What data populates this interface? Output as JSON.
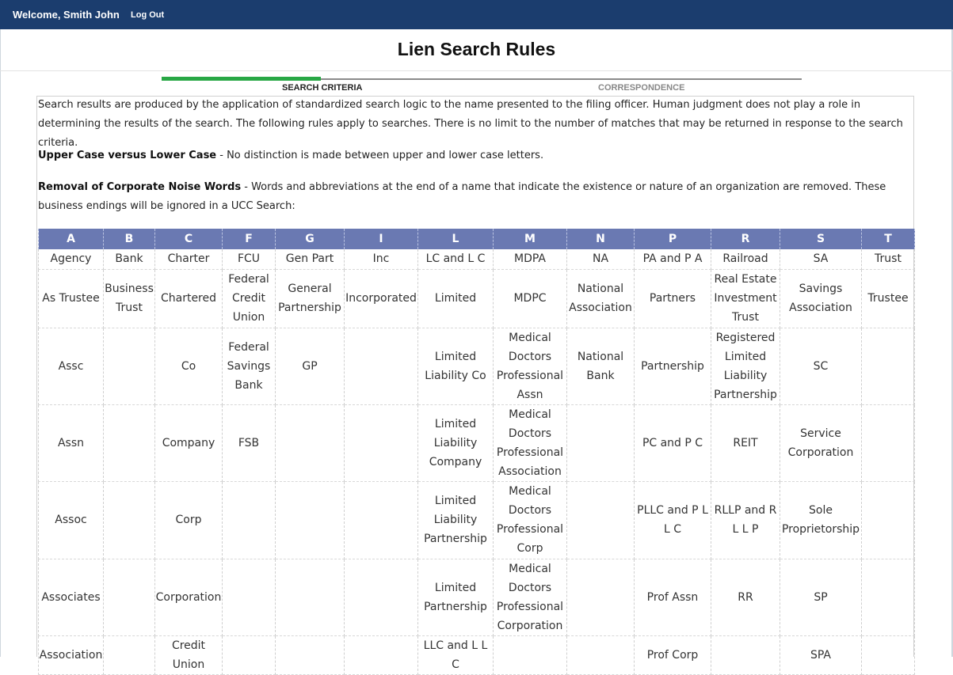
{
  "header": {
    "welcome": "Welcome, Smith John",
    "logout": "Log Out"
  },
  "page": {
    "title": "Lien Search Rules"
  },
  "steps": {
    "step1": "SEARCH CRITERIA",
    "step2": "CORRESPONDENCE",
    "active_color": "#28a745"
  },
  "content": {
    "intro": "Search results are produced by the application of standardized search logic to the name presented to the filing officer. Human judgment does not play a role in determining the results of the search. The following rules apply to searches. There is no limit to the number of matches that may be returned in response to the search criteria.",
    "rule1_title": "Upper Case versus Lower Case",
    "rule1_text": " - No distinction is made between upper and lower case letters.",
    "rule2_title": "Removal of Corporate Noise Words",
    "rule2_text": " - Words and abbreviations at the end of a name that indicate the existence or nature of an organization are removed. These business endings will be ignored in a UCC Search:"
  },
  "table": {
    "header_color": "#6a79b2",
    "headers": [
      "A",
      "B",
      "C",
      "F",
      "G",
      "I",
      "L",
      "M",
      "N",
      "P",
      "R",
      "S",
      "T"
    ],
    "rows": [
      [
        "Agency",
        "Bank",
        "Charter",
        "FCU",
        "Gen Part",
        "Inc",
        "LC and L C",
        "MDPA",
        "NA",
        "PA and P A",
        "Railroad",
        "SA",
        "Trust"
      ],
      [
        "As Trustee",
        "Business Trust",
        "Chartered",
        "Federal Credit Union",
        "General Partnership",
        "Incorporated",
        "Limited",
        "MDPC",
        "National Association",
        "Partners",
        "Real Estate Investment Trust",
        "Savings Association",
        "Trustee"
      ],
      [
        "Assc",
        "",
        "Co",
        "Federal Savings Bank",
        "GP",
        "",
        "Limited Liability Co",
        "Medical Doctors Professional Assn",
        "National Bank",
        "Partnership",
        "Registered Limited Liability Partnership",
        "SC",
        ""
      ],
      [
        "Assn",
        "",
        "Company",
        "FSB",
        "",
        "",
        "Limited Liability Company",
        "Medical Doctors Professional Association",
        "",
        "PC and P C",
        "REIT",
        "Service Corporation",
        ""
      ],
      [
        "Assoc",
        "",
        "Corp",
        "",
        "",
        "",
        "Limited Liability Partnership",
        "Medical Doctors Professional Corp",
        "",
        "PLLC and P L L C",
        "RLLP and R L L P",
        "Sole Proprietorship",
        ""
      ],
      [
        "Associates",
        "",
        "Corporation",
        "",
        "",
        "",
        "Limited Partnership",
        "Medical Doctors Professional Corporation",
        "",
        "Prof Assn",
        "RR",
        "SP",
        ""
      ],
      [
        "Association",
        "",
        "Credit Union",
        "",
        "",
        "",
        "LLC and L L C",
        "",
        "",
        "Prof Corp",
        "",
        "SPA",
        ""
      ]
    ]
  }
}
